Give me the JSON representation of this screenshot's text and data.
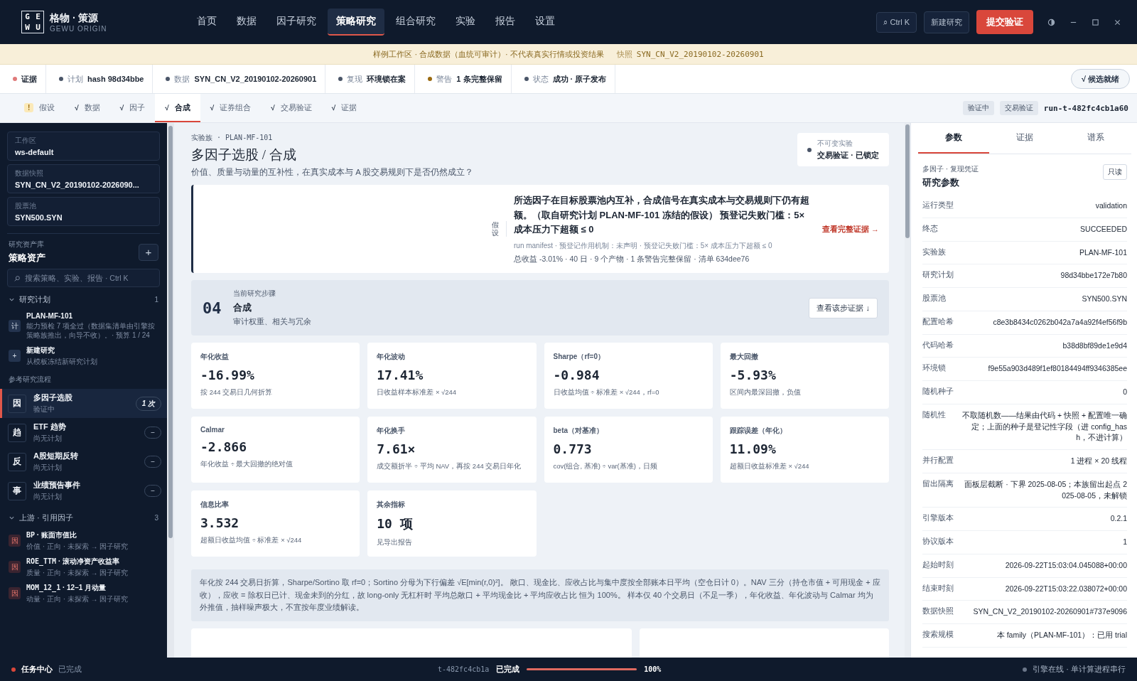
{
  "brand": {
    "logo_letters": [
      "G",
      "E",
      "W",
      "U"
    ],
    "name": "格物 · 策源",
    "sub": "GEWU ORIGIN"
  },
  "nav": [
    {
      "label": "首页",
      "selected": false
    },
    {
      "label": "数据",
      "selected": false
    },
    {
      "label": "因子研究",
      "selected": false
    },
    {
      "label": "策略研究",
      "selected": true
    },
    {
      "label": "组合研究",
      "selected": false
    },
    {
      "label": "实验",
      "selected": false
    },
    {
      "label": "报告",
      "selected": false
    },
    {
      "label": "设置",
      "selected": false
    }
  ],
  "header_actions": {
    "search": "⌕ Ctrl K",
    "new": "新建研究",
    "submit": "提交验证"
  },
  "banner": {
    "text": "样例工作区 · 合成数据（血统可审计）· 不代表真实行情或投资结果",
    "snapshot_label": "快照",
    "snapshot": "SYN_CN_V2_20190102-20260901"
  },
  "status_items": [
    {
      "label": "证据",
      "value": "",
      "color": "#e07a7a"
    },
    {
      "label": "计划",
      "value": "hash 98d34bbe",
      "color": "#4a5568"
    },
    {
      "label": "数据",
      "value": "SYN_CN_V2_20190102-20260901",
      "color": "#4a5568"
    },
    {
      "label": "复现",
      "value": "环境锁在案",
      "color": "#4a5568"
    },
    {
      "label": "警告",
      "value": "1 条完整保留",
      "color": "#9a6a10"
    },
    {
      "label": "状态",
      "value": "成功 · 原子发布",
      "color": "#4a5568"
    }
  ],
  "ready_button": "√ 候选就绪",
  "steps": [
    {
      "mark": "!",
      "kind": "warn",
      "label": "假设",
      "selected": false
    },
    {
      "mark": "√",
      "kind": "done",
      "label": "数据",
      "selected": false
    },
    {
      "mark": "√",
      "kind": "done",
      "label": "因子",
      "selected": false
    },
    {
      "mark": "√",
      "kind": "done",
      "label": "合成",
      "selected": true
    },
    {
      "mark": "√",
      "kind": "done",
      "label": "证券组合",
      "selected": false
    },
    {
      "mark": "√",
      "kind": "done",
      "label": "交易验证",
      "selected": false
    },
    {
      "mark": "√",
      "kind": "done",
      "label": "证据",
      "selected": false
    }
  ],
  "run_tags": [
    "验证中",
    "交易验证"
  ],
  "run_id": "run-t-482fc4cb1a60",
  "sidebar": {
    "fields": [
      {
        "label": "工作区",
        "value": "ws-default"
      },
      {
        "label": "数据快照",
        "value": "SYN_CN_V2_20190102-2026090..."
      },
      {
        "label": "股票池",
        "value": "SYN500.SYN"
      }
    ],
    "library_caption": "研究资产库",
    "library_title": "策略资产",
    "add": "+",
    "search": {
      "placeholder": "搜索策略、实验、报告 · Ctrl K"
    },
    "plans": {
      "title": "研究计划",
      "count": "1",
      "expanded": true,
      "items": [
        {
          "badge": "计",
          "title": "PLAN-MF-101",
          "sub": "能力预检 7 项全过（数据集清单由引擎按策略族推出，向导不收）。· 预算 1 / 24"
        },
        {
          "badge": "+",
          "title": "新建研究",
          "sub": "从模板冻结新研究计划"
        }
      ]
    },
    "flows_caption": "参考研究流程",
    "flows": [
      {
        "badge": "因",
        "title": "多因子选股",
        "sub": "验证中",
        "selected": true,
        "kind": "count",
        "pill": "1 次"
      },
      {
        "badge": "趋",
        "title": "ETF 趋势",
        "sub": "尚无计划",
        "selected": false,
        "kind": "empty",
        "pill": "−"
      },
      {
        "badge": "反",
        "title": "A股短期反转",
        "sub": "尚无计划",
        "selected": false,
        "kind": "empty",
        "pill": "−"
      },
      {
        "badge": "事",
        "title": "业绩预告事件",
        "sub": "尚无计划",
        "selected": false,
        "kind": "empty",
        "pill": "−"
      }
    ],
    "factors": {
      "title": "上游 · 引用因子",
      "count": "3",
      "expanded": true,
      "items": [
        {
          "badge": "因",
          "code": "BP",
          "name": "· 账面市值比",
          "sub": "价值 · 正向 · 未探索 → 因子研究"
        },
        {
          "badge": "因",
          "code": "ROE_TTM",
          "name": "· 滚动净资产收益率",
          "sub": "质量 · 正向 · 未探索 → 因子研究"
        },
        {
          "badge": "因",
          "code": "MOM_12_1",
          "name": "· 12–1 月动量",
          "sub": "动量 · 正向 · 未探索 → 因子研究"
        }
      ]
    }
  },
  "main": {
    "eyebrow": "实验族 · PLAN-MF-101",
    "title": "多因子选股 / 合成",
    "question": "价值、质量与动量的互补性，在真实成本与 A 股交易规则下是否仍然成立？",
    "lock": {
      "caption": "不可变实验",
      "text": "交易验证 · 已锁定"
    },
    "hypothesis": {
      "label": "假设",
      "text": "所选因子在目标股票池内互补，合成信号在真实成本与交易规则下仍有超额。（取自研究计划 PLAN-MF-101 冻结的假设）  预登记失败门槛：5× 成本压力下超额 ≤ 0",
      "meta": "run manifest · 预登记作用机制：未声明 · 预登记失败门槛：5× 成本压力下超额 ≤ 0",
      "summary": "总收益 -3.01% · 40 日 · 9 个产物 · 1 条警告完整保留 · 清单 634dee76",
      "link": "查看完整证据 →"
    },
    "step": {
      "number": "04",
      "caption": "当前研究步骤",
      "title": "合成",
      "sub": "审计权重、相关与冗余",
      "button": "查看该步证据 ↓"
    },
    "metrics": [
      {
        "label": "年化收益",
        "value": "-16.99%",
        "note": "按 244 交易日几何折算"
      },
      {
        "label": "年化波动",
        "value": "17.41%",
        "note": "日收益样本标准差 × √244"
      },
      {
        "label": "Sharpe（rf=0）",
        "value": "-0.984",
        "note": "日收益均值 ÷ 标准差 × √244，rf=0"
      },
      {
        "label": "最大回撤",
        "value": "-5.93%",
        "note": "区间内最深回撤，负值"
      },
      {
        "label": "Calmar",
        "value": "-2.866",
        "note": "年化收益 ÷ 最大回撤的绝对值"
      },
      {
        "label": "年化换手",
        "value": "7.61×",
        "note": "成交额折半 ÷ 平均 NAV，再按 244 交易日年化"
      },
      {
        "label": "beta（对基准）",
        "value": "0.773",
        "note": "cov(组合, 基准) ÷ var(基准)，日频"
      },
      {
        "label": "跟踪误差（年化）",
        "value": "11.09%",
        "note": "超额日收益标准差 × √244"
      },
      {
        "label": "信息比率",
        "value": "3.532",
        "note": "超额日收益均值 ÷ 标准差 × √244"
      },
      {
        "label": "其余指标",
        "value": "10 项",
        "note": "见导出报告"
      }
    ],
    "note": "年化按 244 交易日折算，Sharpe/Sortino 取 rf=0；Sortino 分母为下行偏差 √E[min(r,0)²]。 敞口、现金比、应收占比与集中度按全部账本日平均（空仓日计 0）。NAV 三分（持仓市值 + 可用现金 + 应收），应收 = 除权日已计、现金未到的分红，故 long-only 无杠杆时 平均总敞口 + 平均现金比 + 平均应收占比 恒为 100%。 样本仅 40 个交易日（不足一季），年化收益、年化波动与 Calmar 均为外推值，抽样噪声极大，不宜按年度业绩解读。"
  },
  "right_panel": {
    "tabs": [
      {
        "label": "参数",
        "selected": true
      },
      {
        "label": "证据",
        "selected": false
      },
      {
        "label": "谱系",
        "selected": false
      }
    ],
    "caption": "多因子 · 复现凭证",
    "title": "研究参数",
    "badge": "只读",
    "params": [
      {
        "key": "运行类型",
        "value": "validation"
      },
      {
        "key": "终态",
        "value": "SUCCEEDED"
      },
      {
        "key": "实验族",
        "value": "PLAN-MF-101"
      },
      {
        "key": "研究计划",
        "value": "98d34bbe172e7b80"
      },
      {
        "key": "股票池",
        "value": "SYN500.SYN"
      },
      {
        "key": "配置哈希",
        "value": "c8e3b8434c0262b042a7a4a92f4ef56f9b"
      },
      {
        "key": "代码哈希",
        "value": "b38d8bf89de1e9d4"
      },
      {
        "key": "环境锁",
        "value": "f9e55a903d489f1ef80184494ff9346385ee"
      },
      {
        "key": "随机种子",
        "value": "0"
      },
      {
        "key": "随机性",
        "value": "不取随机数——结果由代码 + 快照 + 配置唯一确定；上面的种子是登记性字段（进 config_hash，不进计算）"
      },
      {
        "key": "并行配置",
        "value": "1 进程 × 20 线程"
      },
      {
        "key": "留出隔离",
        "value": "面板层截断 · 下界 2025-08-05；本族留出起点 2025-08-05，未解锁"
      },
      {
        "key": "引擎版本",
        "value": "0.2.1"
      },
      {
        "key": "协议版本",
        "value": "1"
      },
      {
        "key": "起始时刻",
        "value": "2026-09-22T15:03:04.045088+00:00"
      },
      {
        "key": "结束时刻",
        "value": "2026-09-22T15:03:22.038072+00:00"
      },
      {
        "key": "数据快照",
        "value": "SYN_CN_V2_20190102-20260901#737e9096"
      },
      {
        "key": "搜索规模",
        "value": "本 family（PLAN-MF-101）：已用 trial"
      }
    ]
  },
  "footer": {
    "task_center": "任务中心",
    "task_status": "已完成",
    "run_id": "t-482fc4cb1a",
    "progress_status": "已完成",
    "level": 1.0,
    "percent": "100%",
    "engine": "引擎在线 · 单计算进程串行"
  }
}
